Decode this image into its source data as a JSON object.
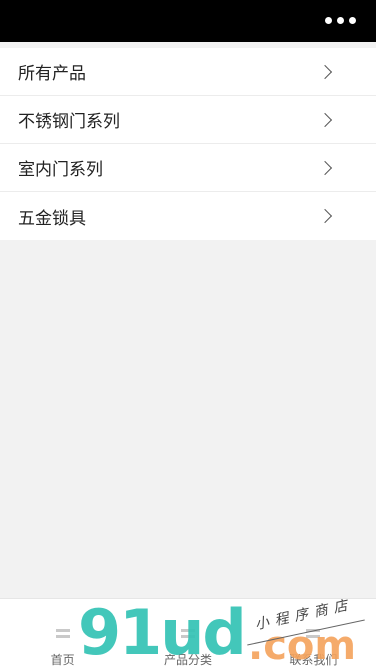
{
  "nav": {
    "more_icon": "more-dots-icon"
  },
  "categories": [
    {
      "label": "所有产品"
    },
    {
      "label": "不锈钢门系列"
    },
    {
      "label": "室内门系列"
    },
    {
      "label": "五金锁具"
    }
  ],
  "tab_bar": {
    "tabs": [
      {
        "label": "首页",
        "icon": "menu-lines-icon"
      },
      {
        "label": "产品分类",
        "icon": "menu-lines-icon"
      },
      {
        "label": "联系我们",
        "icon": "menu-lines-icon"
      }
    ]
  },
  "watermark": {
    "logo": "91ud",
    "domain": ".com",
    "tagline": "小程序商店"
  },
  "colors": {
    "nav_bg": "#000000",
    "page_bg": "#f2f2f2",
    "watermark_teal": "#34c3b5",
    "watermark_orange": "#f4a25c"
  }
}
